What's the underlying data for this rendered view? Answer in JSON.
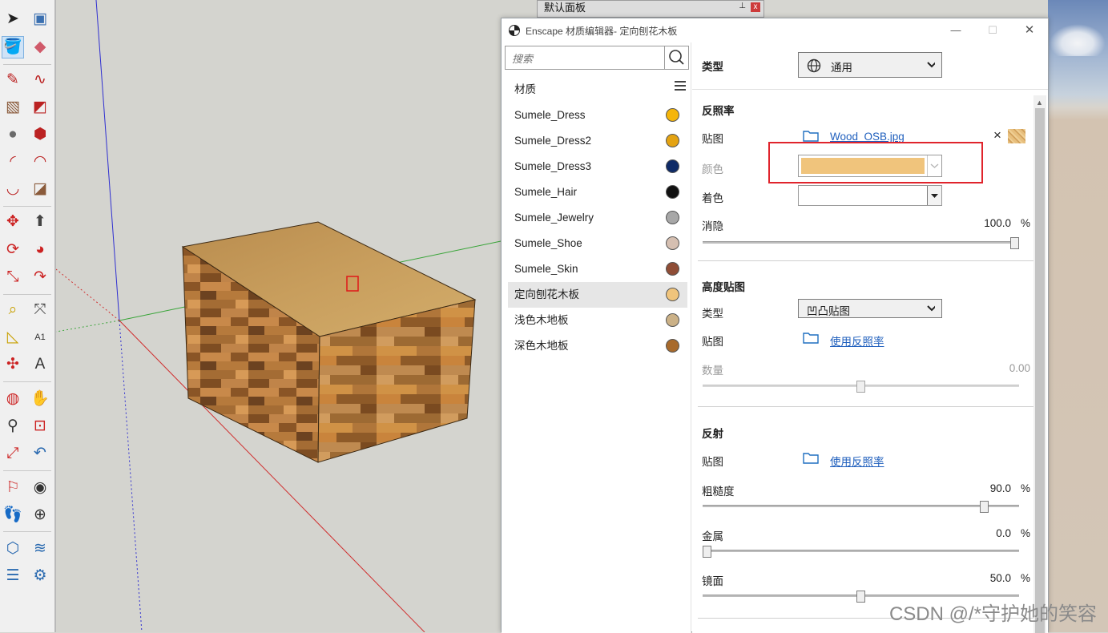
{
  "default_panel": {
    "title": "默认面板",
    "pin": "⊥",
    "close": "x"
  },
  "window": {
    "title": "Enscape 材质编辑器- 定向刨花木板",
    "minimize": "—",
    "maximize": "☐",
    "close": "✕"
  },
  "search": {
    "placeholder": "搜索"
  },
  "materials_header": "材质",
  "materials": [
    {
      "name": "Sumele_Dress",
      "color": "#f5b50a"
    },
    {
      "name": "Sumele_Dress2",
      "color": "#e4a312"
    },
    {
      "name": "Sumele_Dress3",
      "color": "#0e2a66"
    },
    {
      "name": "Sumele_Hair",
      "color": "#111111"
    },
    {
      "name": "Sumele_Jewelry",
      "color": "#a7a7a7"
    },
    {
      "name": "Sumele_Shoe",
      "color": "#d5bfb1"
    },
    {
      "name": "Sumele_Skin",
      "color": "#8f4d36"
    },
    {
      "name": "定向刨花木板",
      "color": "#f0c47c",
      "selected": true
    },
    {
      "name": "浅色木地板",
      "color": "#cbb187"
    },
    {
      "name": "深色木地板",
      "color": "#a86a2c"
    }
  ],
  "type_section": {
    "label": "类型",
    "value": "通用"
  },
  "albedo": {
    "heading": "反照率",
    "texture_label": "贴图",
    "texture_file": "Wood_OSB.jpg",
    "remove": "×",
    "color_label": "颜色",
    "color_value": "#f0c47c",
    "tint_label": "着色",
    "fade_label": "消隐",
    "fade_value": "100.0",
    "fade_unit": "%",
    "fade_level": 1.0
  },
  "height": {
    "heading": "高度贴图",
    "type_label": "类型",
    "type_value": "凹凸贴图",
    "texture_label": "贴图",
    "texture_link": "使用反照率",
    "amount_label": "数量",
    "amount_value": "0.00",
    "amount_level": 0.5
  },
  "reflection": {
    "heading": "反射",
    "texture_label": "贴图",
    "texture_link": "使用反照率",
    "roughness_label": "粗糙度",
    "roughness_value": "90.0",
    "roughness_level": 0.9,
    "metal_label": "金属",
    "metal_value": "0.0",
    "metal_level": 0.0,
    "specular_label": "镜面",
    "specular_value": "50.0",
    "specular_level": 0.5,
    "unit": "%"
  },
  "watermark": "CSDN @/*守护她的笑容"
}
